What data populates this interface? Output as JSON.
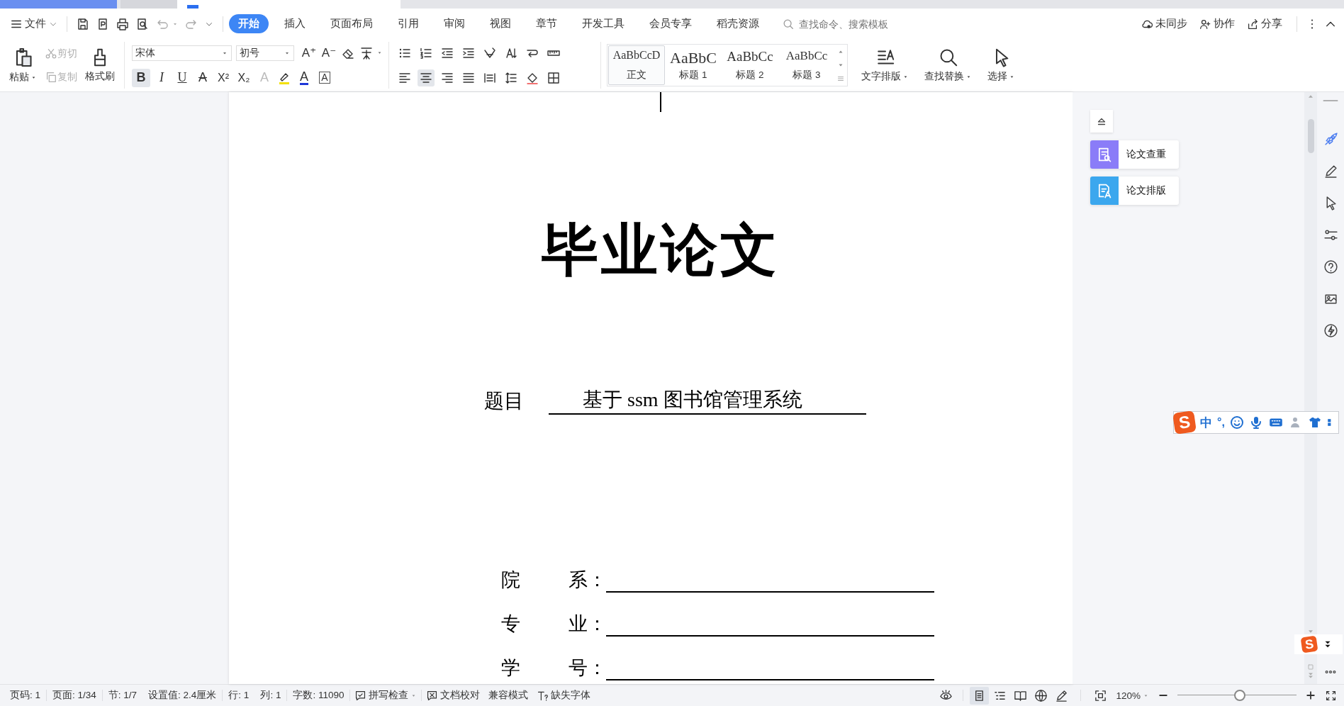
{
  "menu": {
    "file": "文件",
    "tabs": [
      {
        "label": "开始",
        "selected": true
      },
      {
        "label": "插入",
        "selected": false
      },
      {
        "label": "页面布局",
        "selected": false
      },
      {
        "label": "引用",
        "selected": false
      },
      {
        "label": "审阅",
        "selected": false
      },
      {
        "label": "视图",
        "selected": false
      },
      {
        "label": "章节",
        "selected": false
      },
      {
        "label": "开发工具",
        "selected": false
      },
      {
        "label": "会员专享",
        "selected": false
      },
      {
        "label": "稻壳资源",
        "selected": false
      }
    ],
    "search": {
      "placeholder": "查找命令、搜索模板"
    },
    "actions": [
      "未同步",
      "协作",
      "分享"
    ]
  },
  "ribbon": {
    "paste": "粘贴",
    "cut": {
      "label": "剪切",
      "disabled": true
    },
    "copy": {
      "label": "复制",
      "disabled": true
    },
    "format_painter": "格式刷",
    "font_name": "宋体",
    "font_size": "初号",
    "size_buttons": [
      "A⁺",
      "A⁻"
    ],
    "font_buttons": [
      {
        "kind": "bold",
        "label": "B",
        "on": true
      },
      {
        "kind": "italic",
        "label": "I",
        "on": false
      },
      {
        "kind": "underline",
        "label": "U",
        "on": false
      },
      {
        "kind": "strike",
        "label": "A",
        "on": false
      },
      {
        "kind": "super",
        "label": "X²",
        "on": false
      },
      {
        "kind": "sub",
        "label": "X₂",
        "on": false
      },
      {
        "kind": "effect",
        "label": "A",
        "on": false
      },
      {
        "kind": "highlight",
        "on": false
      },
      {
        "kind": "color",
        "label": "A",
        "on": false
      },
      {
        "kind": "border",
        "label": "A",
        "on": false
      }
    ],
    "alignment": [
      {
        "selected": false
      },
      {
        "selected": true
      },
      {
        "selected": false
      },
      {
        "selected": false
      },
      {
        "selected": false
      }
    ],
    "styles": [
      {
        "preview": "AaBbCcD",
        "name": "正文",
        "selected": true
      },
      {
        "preview": "AaBbC",
        "name": "标题 1",
        "selected": false
      },
      {
        "preview": "AaBbCc",
        "name": "标题 2",
        "selected": false
      },
      {
        "preview": "AaBbCc",
        "name": "标题 3",
        "selected": false
      }
    ],
    "buttons": [
      "文字排版",
      "查找替换",
      "选择"
    ]
  },
  "document": {
    "title": "毕业论文",
    "subject": {
      "label": "题目",
      "value": "基于 ssm 图书馆管理系统"
    },
    "fields": [
      {
        "label_start": "院",
        "label_end": "系："
      },
      {
        "label_start": "专",
        "label_end": "业："
      },
      {
        "label_start": "学",
        "label_end": "号："
      }
    ]
  },
  "side_panel": {
    "items": [
      {
        "label": "论文查重",
        "color": "#8a7cf8"
      },
      {
        "label": "论文排版",
        "color": "#3ba7ee"
      }
    ]
  },
  "ime": {
    "logo": "S",
    "mode": "中",
    "punctuation": "°,"
  },
  "ime_mini": {
    "logo": "S"
  },
  "status_bar": {
    "items": [
      "页码: 1",
      "页面: 1/34",
      "节: 1/7",
      "设置值: 2.4厘米",
      "行: 1",
      "列: 1",
      "字数: 11090"
    ],
    "tools": [
      {
        "kind": "spell",
        "label": "拼写检查"
      },
      {
        "kind": "proof",
        "label": "文档校对"
      },
      {
        "kind": "plain",
        "label": "兼容模式"
      },
      {
        "kind": "font",
        "label": "缺失字体"
      }
    ],
    "views": [
      {
        "selected": true
      },
      {
        "selected": false
      },
      {
        "selected": false
      },
      {
        "selected": false
      },
      {
        "selected": false
      }
    ],
    "zoom": "120%",
    "zoom_slider": {
      "level": 0.52
    }
  }
}
